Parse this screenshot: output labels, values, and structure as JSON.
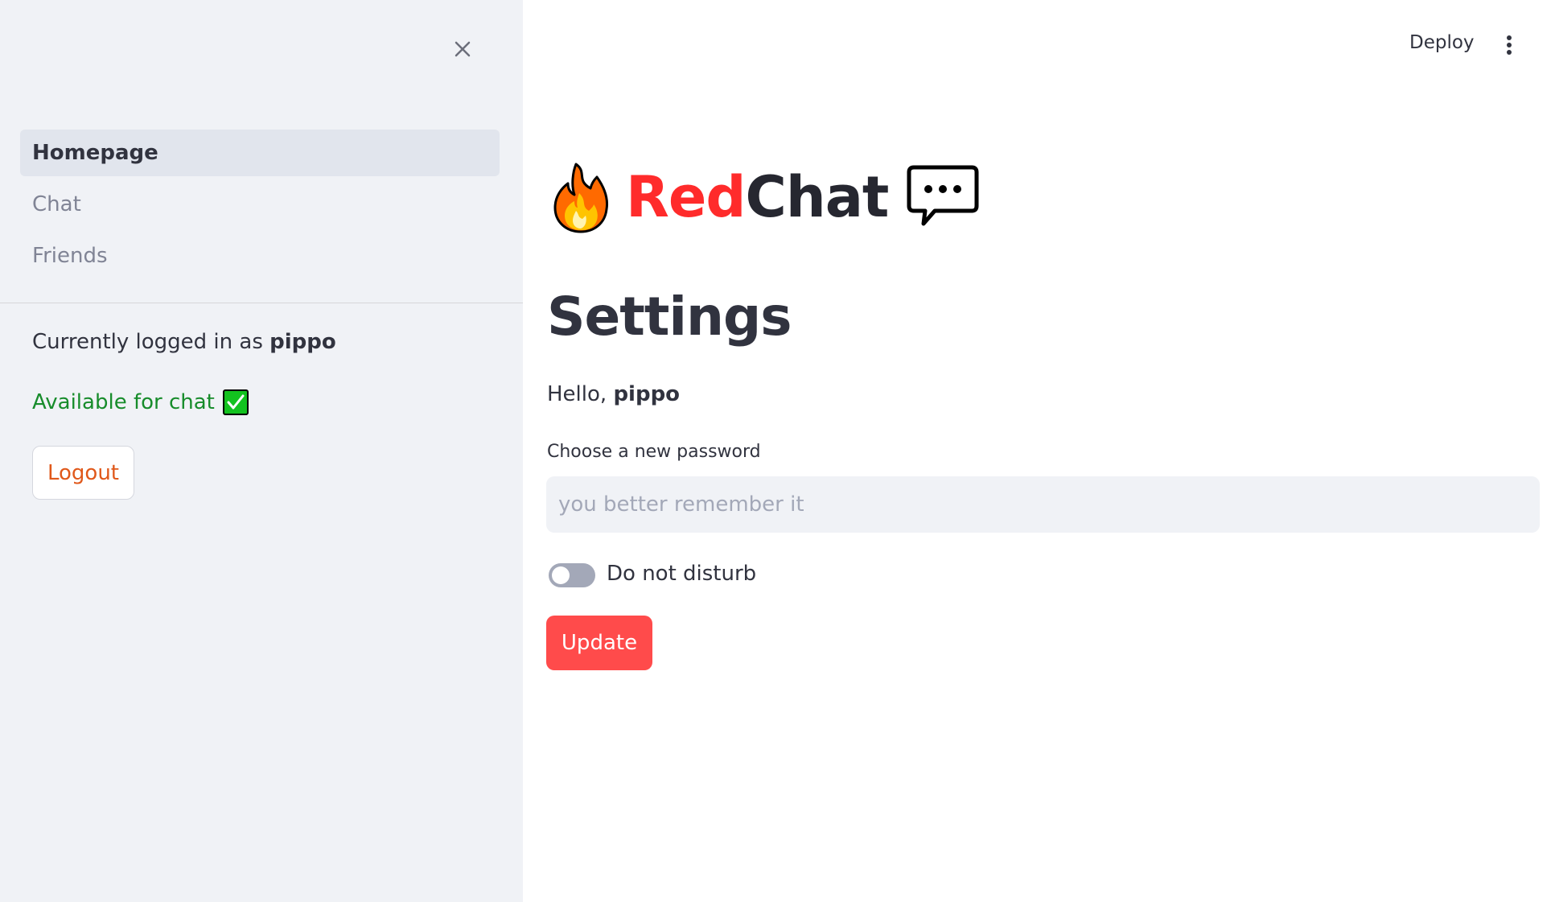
{
  "sidebar": {
    "nav_items": [
      {
        "label": "Homepage",
        "active": true
      },
      {
        "label": "Chat",
        "active": false
      },
      {
        "label": "Friends",
        "active": false
      }
    ],
    "logged_in_prefix": "Currently logged in as ",
    "username": "pippo",
    "status_text": "Available for chat",
    "status_icon": "check-box-icon",
    "logout_label": "Logout"
  },
  "topbar": {
    "deploy_label": "Deploy",
    "menu_icon": "more-vertical-icon"
  },
  "main": {
    "brand": {
      "red_part": "Red",
      "dark_part": "Chat",
      "left_icon": "fire-icon",
      "right_icon": "speech-bubble-icon"
    },
    "title": "Settings",
    "hello_prefix": "Hello, ",
    "hello_user": "pippo",
    "password_label": "Choose a new password",
    "password_placeholder": "you better remember it",
    "password_value": "",
    "toggle_label": "Do not disturb",
    "toggle_on": false,
    "update_label": "Update"
  },
  "colors": {
    "sidebar_bg": "#f0f2f6",
    "accent_red": "#ff4b4b",
    "brand_red": "#ff2b2b",
    "status_green": "#178c2b",
    "logout_orange": "#e0581a"
  }
}
